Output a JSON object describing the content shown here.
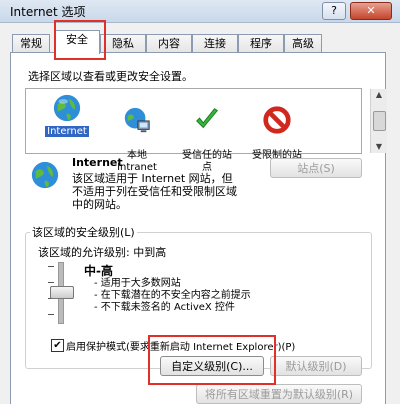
{
  "window": {
    "title": "Internet 选项",
    "help_label": "?",
    "close_label": "✕"
  },
  "tabs": [
    "常规",
    "安全",
    "隐私",
    "内容",
    "连接",
    "程序",
    "高级"
  ],
  "instruction": "选择区域以查看或更改安全设置。",
  "zones": [
    {
      "label": "Internet",
      "icon": "globe-icon"
    },
    {
      "label": "本地\nIntranet",
      "icon": "intranet-icon"
    },
    {
      "label": "受信任的站\n点",
      "icon": "checkmark-icon"
    },
    {
      "label": "受限制的站\n点",
      "icon": "restricted-icon"
    }
  ],
  "zone_detail": {
    "name": "Internet",
    "description": [
      "该区域适用于 Internet 网站，但",
      "不适用于列在受信任和受限制区域",
      "中的网站。"
    ],
    "sites_button": "站点(S)"
  },
  "security_level": {
    "group_title": "该区域的安全级别(L)",
    "allowed": "该区域的允许级别: 中到高",
    "level_name": "中-高",
    "bullets": [
      "- 适用于大多数网站",
      "- 在下载潜在的不安全内容之前提示",
      "- 不下载未签名的 ActiveX 控件"
    ]
  },
  "protected_mode": {
    "label": "启用保护模式(要求重新启动 Internet Explorer)(P)",
    "checked": true,
    "check_glyph": "✔"
  },
  "buttons": {
    "custom_level": "自定义级别(C)...",
    "default_level": "默认级别(D)",
    "reset_all": "将所有区域重置为默认级别(R)"
  },
  "colors": {
    "highlight": "#e0302a",
    "selection": "#3166c4"
  }
}
